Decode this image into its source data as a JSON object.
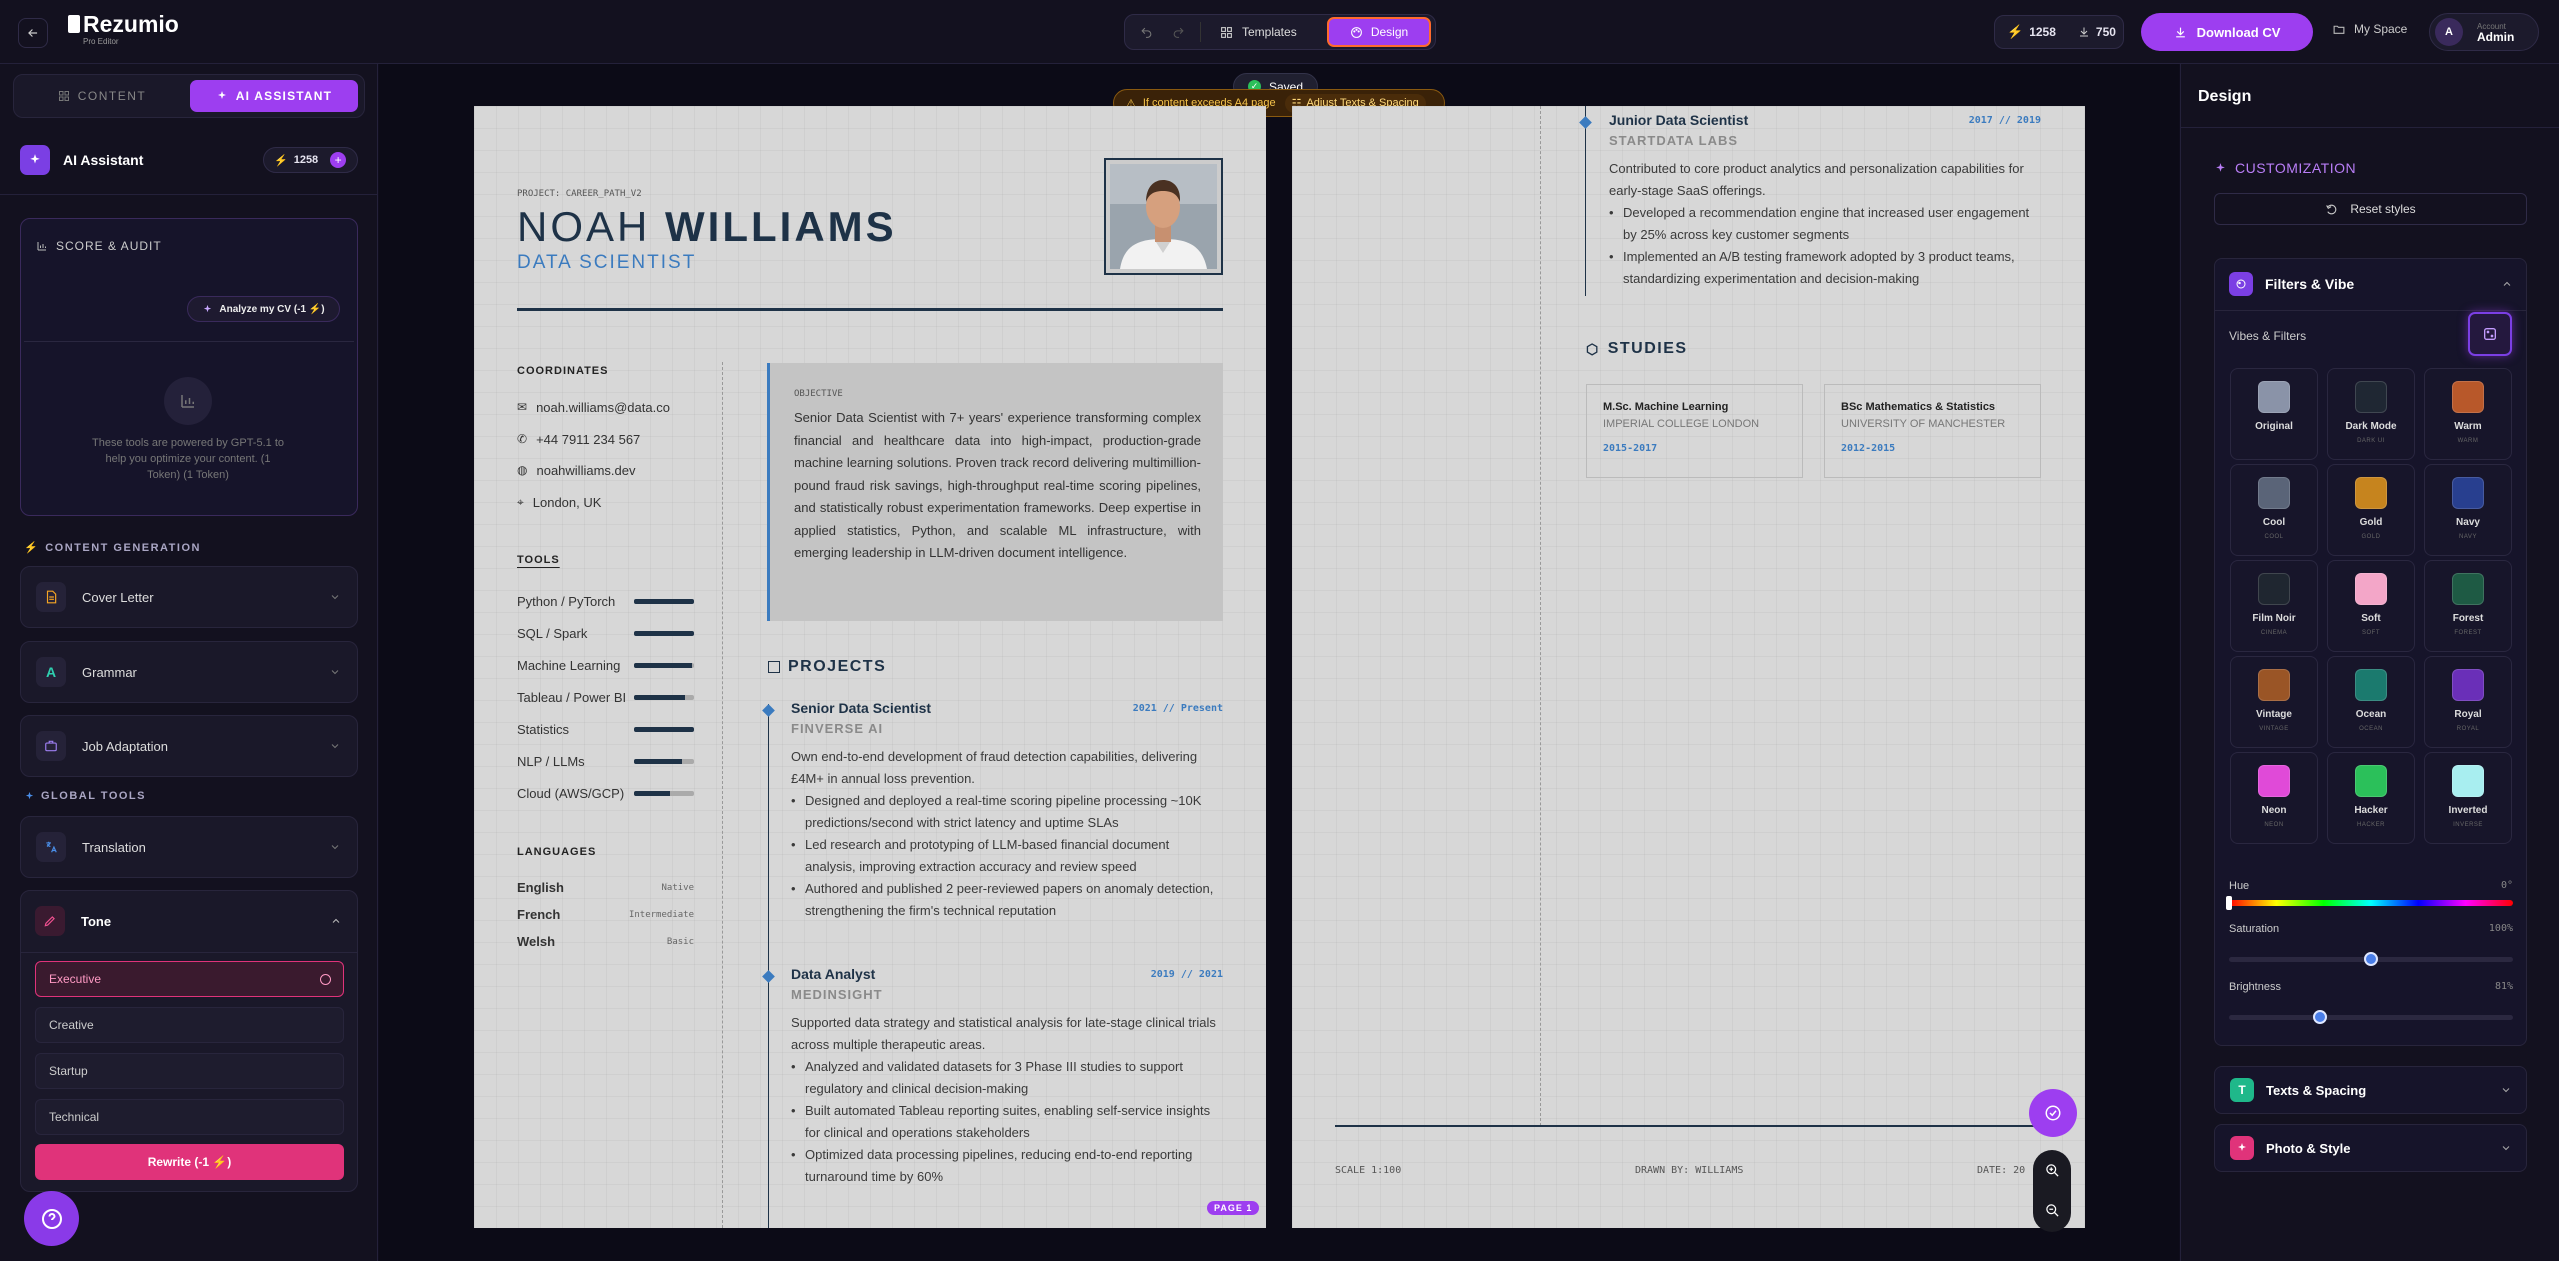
{
  "app": {
    "name": "Rezumio",
    "subtitle": "Pro Editor"
  },
  "topbar": {
    "templates_label": "Templates",
    "design_label": "Design",
    "tokens": "1258",
    "downloads": "750",
    "download_label": "Download CV",
    "myspace_label": "My Space",
    "account_caption": "Account",
    "account_name": "Admin",
    "avatar_letter": "A"
  },
  "toast": {
    "saved": "Saved",
    "warning": "If content exceeds A4 page",
    "adjust": "Adjust Texts & Spacing"
  },
  "sidebar": {
    "tabs": [
      {
        "label": "CONTENT"
      },
      {
        "label": "AI ASSISTANT"
      }
    ],
    "assistant_title": "AI Assistant",
    "assistant_tokens": "1258",
    "score": {
      "title": "SCORE & AUDIT",
      "analyze": "Analyze my CV (-1 ⚡)",
      "info": "These tools are powered by GPT-5.1 to help you optimize your content. (1 Token) (1 Token)"
    },
    "content_gen_title": "CONTENT GENERATION",
    "tools": [
      {
        "label": "Cover Letter"
      },
      {
        "label": "Grammar"
      },
      {
        "label": "Job Adaptation"
      }
    ],
    "global_title": "GLOBAL TOOLS",
    "translation": "Translation",
    "tone": {
      "label": "Tone",
      "options": [
        {
          "label": "Executive"
        },
        {
          "label": "Creative"
        },
        {
          "label": "Startup"
        },
        {
          "label": "Technical"
        }
      ],
      "rewrite": "Rewrite (-1 ⚡)"
    }
  },
  "cv": {
    "project": "PROJECT: CAREER_PATH_V2",
    "first_name": "NOAH",
    "last_name": "WILLIAMS",
    "role": "DATA SCIENTIST",
    "coordinates_title": "COORDINATES",
    "contacts": {
      "email": "noah.williams@data.co",
      "phone": "+44 7911 234 567",
      "web": "noahwilliams.dev",
      "location": "London, UK"
    },
    "tools_title": "TOOLS",
    "skills": [
      {
        "name": "Python / PyTorch",
        "level": 1.0
      },
      {
        "name": "SQL / Spark",
        "level": 1.0
      },
      {
        "name": "Machine Learning",
        "level": 0.97
      },
      {
        "name": "Tableau / Power BI",
        "level": 0.85
      },
      {
        "name": "Statistics",
        "level": 1.0
      },
      {
        "name": "NLP / LLMs",
        "level": 0.8
      },
      {
        "name": "Cloud (AWS/GCP)",
        "level": 0.6
      }
    ],
    "languages_title": "LANGUAGES",
    "languages": [
      {
        "name": "English",
        "level": "Native"
      },
      {
        "name": "French",
        "level": "Intermediate"
      },
      {
        "name": "Welsh",
        "level": "Basic"
      }
    ],
    "objective_title": "OBJECTIVE",
    "objective": "Senior Data Scientist with 7+ years' experience transforming complex financial and healthcare data into high-impact, production-grade machine learning solutions. Proven track record delivering multimillion-pound fraud risk savings, high-throughput real-time scoring pipelines, and statistically robust experimentation frameworks. Deep expertise in applied statistics, Python, and scalable ML infrastructure, with emerging leadership in LLM-driven document intelligence.",
    "projects_title": "PROJECTS",
    "jobs": [
      {
        "title": "Senior Data Scientist",
        "dates": "2021 // Present",
        "company": "FINVERSE AI",
        "summary": "Own end-to-end development of fraud detection capabilities, delivering £4M+ in annual loss prevention.",
        "bullets": [
          "Designed and deployed a real-time scoring pipeline processing ~10K predictions/second with strict latency and uptime SLAs",
          "Led research and prototyping of LLM-based financial document analysis, improving extraction accuracy and review speed",
          "Authored and published 2 peer-reviewed papers on anomaly detection, strengthening the firm's technical reputation"
        ]
      },
      {
        "title": "Data Analyst",
        "dates": "2019 // 2021",
        "company": "MEDINSIGHT",
        "summary": "Supported data strategy and statistical analysis for late-stage clinical trials across multiple therapeutic areas.",
        "bullets": [
          "Analyzed and validated datasets for 3 Phase III studies to support regulatory and clinical decision-making",
          "Built automated Tableau reporting suites, enabling self-service insights for clinical and operations stakeholders",
          "Optimized data processing pipelines, reducing end-to-end reporting turnaround time by 60%"
        ]
      },
      {
        "title": "Junior Data Scientist",
        "dates": "2017 // 2019",
        "company": "STARTDATA LABS",
        "summary": "Contributed to core product analytics and personalization capabilities for early-stage SaaS offerings.",
        "bullets": [
          "Developed a recommendation engine that increased user engagement by 25% across key customer segments",
          "Implemented an A/B testing framework adopted by 3 product teams, standardizing experimentation and decision-making"
        ]
      }
    ],
    "studies_title": "STUDIES",
    "studies": [
      {
        "degree": "M.Sc. Machine Learning",
        "school": "IMPERIAL COLLEGE LONDON",
        "years": "2015-2017"
      },
      {
        "degree": "BSc Mathematics & Statistics",
        "school": "UNIVERSITY OF MANCHESTER",
        "years": "2012-2015"
      }
    ],
    "page_badge": "PAGE 1",
    "footer": {
      "scale": "SCALE 1:100",
      "drawn": "DRAWN BY: WILLIAMS",
      "date": "DATE: 20"
    }
  },
  "design": {
    "title": "Design",
    "customization": "CUSTOMIZATION",
    "reset": "Reset styles",
    "filters_title": "Filters & Vibe",
    "vibes_label": "Vibes & Filters",
    "vibes": [
      {
        "name": "Original",
        "sub": "",
        "color": "#8a93a8"
      },
      {
        "name": "Dark Mode",
        "sub": "DARK UI",
        "color": "#1f2733"
      },
      {
        "name": "Warm",
        "sub": "WARM",
        "color": "#b8582a"
      },
      {
        "name": "Cool",
        "sub": "COOL",
        "color": "#5a6478"
      },
      {
        "name": "Gold",
        "sub": "GOLD",
        "color": "#c6841e"
      },
      {
        "name": "Navy",
        "sub": "NAVY",
        "color": "#283f8f"
      },
      {
        "name": "Film Noir",
        "sub": "CINEMA",
        "color": "#1f2630"
      },
      {
        "name": "Soft",
        "sub": "SOFT",
        "color": "#f3a6c8"
      },
      {
        "name": "Forest",
        "sub": "FOREST",
        "color": "#1e5a44"
      },
      {
        "name": "Vintage",
        "sub": "VINTAGE",
        "color": "#9a5526"
      },
      {
        "name": "Ocean",
        "sub": "OCEAN",
        "color": "#1b7a6e"
      },
      {
        "name": "Royal",
        "sub": "ROYAL",
        "color": "#6a2fb8"
      },
      {
        "name": "Neon",
        "sub": "NEON",
        "color": "#e04ad8"
      },
      {
        "name": "Hacker",
        "sub": "HACKER",
        "color": "#2bc05a"
      },
      {
        "name": "Inverted",
        "sub": "INVERSE",
        "color": "#a8eef0"
      }
    ],
    "hue_label": "Hue",
    "hue_value": "0°",
    "saturation_label": "Saturation",
    "saturation_value": "100%",
    "saturation_level": 0.5,
    "brightness_label": "Brightness",
    "brightness_value": "81%",
    "brightness_level": 0.32,
    "texts_spacing": "Texts & Spacing",
    "photo_style": "Photo & Style"
  },
  "colors": {
    "accent": "#9d3ef0",
    "pink": "#e0337a",
    "navy": "#1e3247",
    "blue": "#3b7bbf"
  }
}
